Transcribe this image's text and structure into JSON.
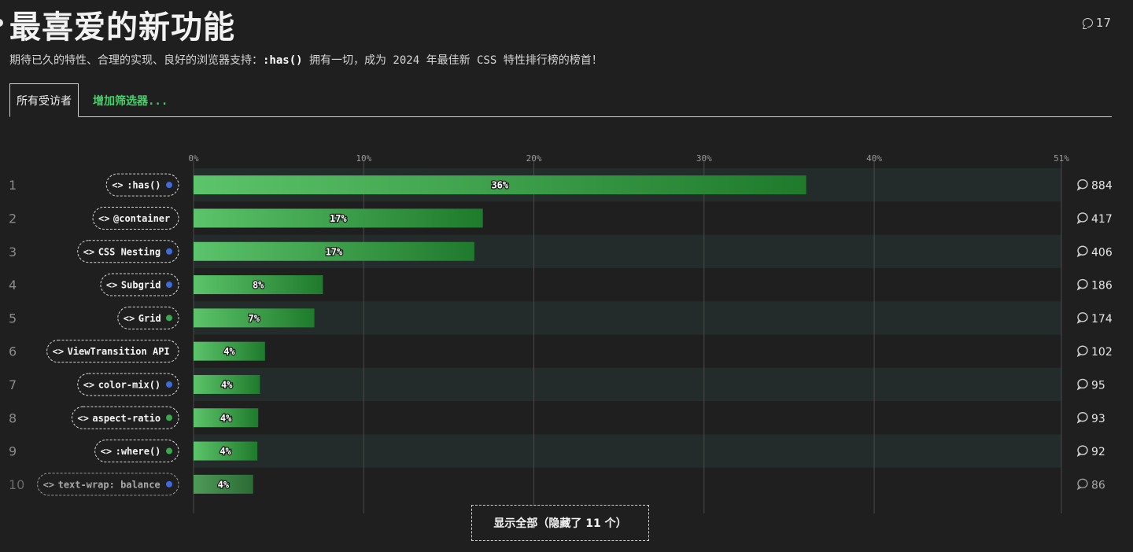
{
  "header": {
    "title": "最喜爱的新功能",
    "comment_count": "17",
    "subtitle_pre": "期待已久的特性、合理的实现、良好的浏览器支持：",
    "subtitle_code": ":has()",
    "subtitle_post": " 拥有一切，成为 2024 年最佳新 CSS 特性排行榜的榜首！"
  },
  "tabs": {
    "all_label": "所有受访者",
    "add_filter_label": "增加筛选器..."
  },
  "show_more_label": "显示全部（隐藏了 11 个）",
  "colors": {
    "bar_light": "#5cc46a",
    "bar_dark": "#1f7a2c",
    "dot_blue": "#3f6bd8",
    "dot_green": "#3aa84c",
    "row_alt": "#242b2b"
  },
  "chart_data": {
    "type": "bar",
    "orientation": "horizontal",
    "x_axis_ticks": [
      "0%",
      "10%",
      "20%",
      "30%",
      "40%",
      "51%"
    ],
    "xlim": [
      0,
      51
    ],
    "grid": true,
    "rows": [
      {
        "rank": "1",
        "label": ":has()",
        "value": 36,
        "value_label": "36%",
        "comments": "884",
        "dot": "blue"
      },
      {
        "rank": "2",
        "label": "@container",
        "value": 17,
        "value_label": "17%",
        "comments": "417",
        "dot": "none"
      },
      {
        "rank": "3",
        "label": "CSS Nesting",
        "value": 16.5,
        "value_label": "17%",
        "comments": "406",
        "dot": "blue"
      },
      {
        "rank": "4",
        "label": "Subgrid",
        "value": 7.6,
        "value_label": "8%",
        "comments": "186",
        "dot": "blue"
      },
      {
        "rank": "5",
        "label": "Grid",
        "value": 7.1,
        "value_label": "7%",
        "comments": "174",
        "dot": "green"
      },
      {
        "rank": "6",
        "label": "ViewTransition API",
        "value": 4.2,
        "value_label": "4%",
        "comments": "102",
        "dot": "none"
      },
      {
        "rank": "7",
        "label": "color-mix()",
        "value": 3.9,
        "value_label": "4%",
        "comments": "95",
        "dot": "blue"
      },
      {
        "rank": "8",
        "label": "aspect-ratio",
        "value": 3.8,
        "value_label": "4%",
        "comments": "93",
        "dot": "green"
      },
      {
        "rank": "9",
        "label": ":where()",
        "value": 3.75,
        "value_label": "4%",
        "comments": "92",
        "dot": "green"
      },
      {
        "rank": "10",
        "label": "text-wrap: balance",
        "value": 3.5,
        "value_label": "4%",
        "comments": "86",
        "dot": "blue"
      }
    ]
  }
}
